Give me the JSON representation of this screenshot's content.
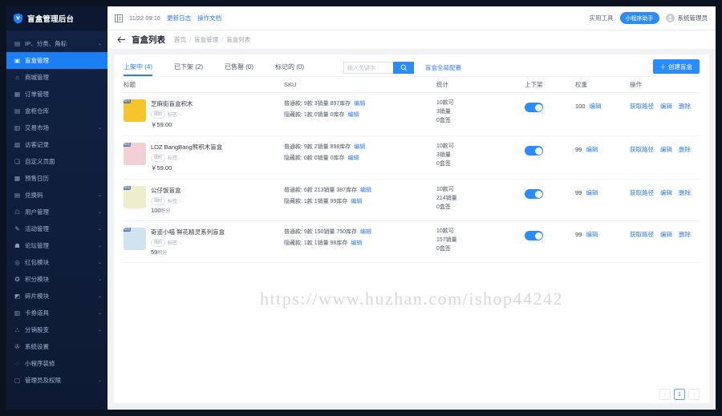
{
  "sidebar": {
    "brand_title": "盲盒管理后台",
    "items": [
      {
        "label": "IP、分类、角标",
        "icon": "tag-icon",
        "arrow": "⌄",
        "active": false
      },
      {
        "label": "盲盒管理",
        "icon": "box-icon",
        "arrow": "",
        "active": true
      },
      {
        "label": "商城管理",
        "icon": "shop-icon",
        "arrow": "",
        "active": false
      },
      {
        "label": "订单管理",
        "icon": "order-icon",
        "arrow": "",
        "active": false
      },
      {
        "label": "盒柜仓库",
        "icon": "warehouse-icon",
        "arrow": "",
        "active": false
      },
      {
        "label": "交易市场",
        "icon": "market-icon",
        "arrow": "⌄",
        "active": false
      },
      {
        "label": "访客记录",
        "icon": "visitor-icon",
        "arrow": "",
        "active": false
      },
      {
        "label": "自定义页面",
        "icon": "page-icon",
        "arrow": "",
        "active": false
      },
      {
        "label": "预售日历",
        "icon": "calendar-icon",
        "arrow": "",
        "active": false
      },
      {
        "label": "兑换码",
        "icon": "code-icon",
        "arrow": "⌄",
        "active": false
      },
      {
        "label": "用户管理",
        "icon": "user-icon",
        "arrow": "⌄",
        "active": false
      },
      {
        "label": "活动管理",
        "icon": "activity-icon",
        "arrow": "⌄",
        "active": false
      },
      {
        "label": "论坛管理",
        "icon": "forum-icon",
        "arrow": "⌄",
        "active": false
      },
      {
        "label": "红包模块",
        "icon": "redpacket-icon",
        "arrow": "⌄",
        "active": false
      },
      {
        "label": "积分模块",
        "icon": "points-icon",
        "arrow": "⌄",
        "active": false
      },
      {
        "label": "碎片模块",
        "icon": "fragment-icon",
        "arrow": "⌄",
        "active": false
      },
      {
        "label": "卡券道具",
        "icon": "coupon-icon",
        "arrow": "⌄",
        "active": false
      },
      {
        "label": "分销股变",
        "icon": "distribution-icon",
        "arrow": "⌄",
        "active": false
      },
      {
        "label": "系统设置",
        "icon": "settings-icon",
        "arrow": "",
        "active": false
      },
      {
        "label": "小程序装修",
        "icon": "decorate-icon",
        "arrow": "",
        "active": false
      },
      {
        "label": "管理员及权限",
        "icon": "admin-icon",
        "arrow": "⌄",
        "active": false
      }
    ]
  },
  "topbar": {
    "collapse_icon": "menu-collapse-icon",
    "update_time": "11/22 09:16",
    "update_log": "更新日志",
    "operation_doc": "操作文档",
    "tools_label": "实用工具",
    "assistant_label": "小程序助手",
    "user_name": "系统管理员"
  },
  "page_head": {
    "back_icon": "back-arrow-icon",
    "title": "盲盒列表",
    "breadcrumb": [
      "首页",
      "盲盒管理",
      "盲盒列表"
    ]
  },
  "tabs": [
    {
      "label": "上架中 (4)",
      "active": true
    },
    {
      "label": "已下架 (2)",
      "active": false
    },
    {
      "label": "已售罄 (0)",
      "active": false
    },
    {
      "label": "标记的 (0)",
      "active": false
    }
  ],
  "search": {
    "placeholder": "输入关键字",
    "button_icon": "search-icon",
    "global_config_label": "盲盒全局配置"
  },
  "create_button": {
    "label": "创建盲盒",
    "icon": "plus-icon"
  },
  "table": {
    "headers": [
      "标题",
      "SKU",
      "统计",
      "上下架",
      "权重",
      "操作"
    ],
    "rows": [
      {
        "thumb_color": "#f6c52b",
        "thumb_tag": "新品",
        "name": "芝麻街盲盒积木",
        "badge": "限时",
        "meta": "标签: -",
        "price": "￥59.00",
        "price_unit": "",
        "sku_normal": "普通款: 9款  3销量  897库存",
        "sku_hidden": "隐藏款: 1款  0销量  0库存",
        "sku_edit": "编辑",
        "stat_1": "10款可",
        "stat_2": "3销量",
        "stat_3": "0盒签",
        "shelf_on": true,
        "weight": "100",
        "weight_edit": "编辑",
        "ops": [
          "获取路径",
          "编辑",
          "删除"
        ]
      },
      {
        "thumb_color": "#f3d0d8",
        "thumb_tag": "新品",
        "name": "LOZ BangBang熊积木盲盒",
        "badge": "限时",
        "meta": "标签: -",
        "price": "￥59.00",
        "price_unit": "",
        "sku_normal": "普通款: 9款  2销量  898库存",
        "sku_hidden": "隐藏款: 0款  0销量  0库存",
        "sku_edit": "编辑",
        "stat_1": "10款可",
        "stat_2": "3销量",
        "stat_3": "0盒签",
        "shelf_on": true,
        "weight": "99",
        "weight_edit": "编辑",
        "ops": [
          "获取路径",
          "编辑",
          "删除"
        ]
      },
      {
        "thumb_color": "#ecefc9",
        "thumb_tag": "新品",
        "name": "公仔饭盲盒",
        "badge": "限时",
        "meta": "标签: -",
        "price": "100",
        "price_unit": "积分",
        "sku_normal": "普通款: 6款  213销量  387库存",
        "sku_hidden": "隐藏款: 1款  1销量  99库存",
        "sku_edit": "编辑",
        "stat_1": "10款可",
        "stat_2": "214销量",
        "stat_3": "0盒签",
        "shelf_on": true,
        "weight": "99",
        "weight_edit": "编辑",
        "ops": [
          "获取路径",
          "编辑",
          "删除"
        ]
      },
      {
        "thumb_color": "#cfe4ee",
        "thumb_tag": "新品",
        "name": "奇迹小喵 鲜花精灵系列盲盒",
        "badge": "限时",
        "meta": "标签: -",
        "price": "59",
        "price_unit": "积分",
        "sku_normal": "普通款: 9款  150销量  750库存",
        "sku_hidden": "隐藏款: 1款  1销量  98库存",
        "sku_edit": "编辑",
        "stat_1": "10款可",
        "stat_2": "157销量",
        "stat_3": "0盒签",
        "shelf_on": true,
        "weight": "99",
        "weight_edit": "编辑",
        "ops": [
          "获取路径",
          "编辑",
          "删除"
        ]
      }
    ]
  },
  "pagination": {
    "prev": "‹",
    "current": "1",
    "next": "›"
  },
  "watermark": "https://www.huzhan.com/ishop44242",
  "colors": {
    "accent": "#2b8cf5",
    "sidebar_bg": "#0f1f3d",
    "link": "#2b7cf0"
  }
}
